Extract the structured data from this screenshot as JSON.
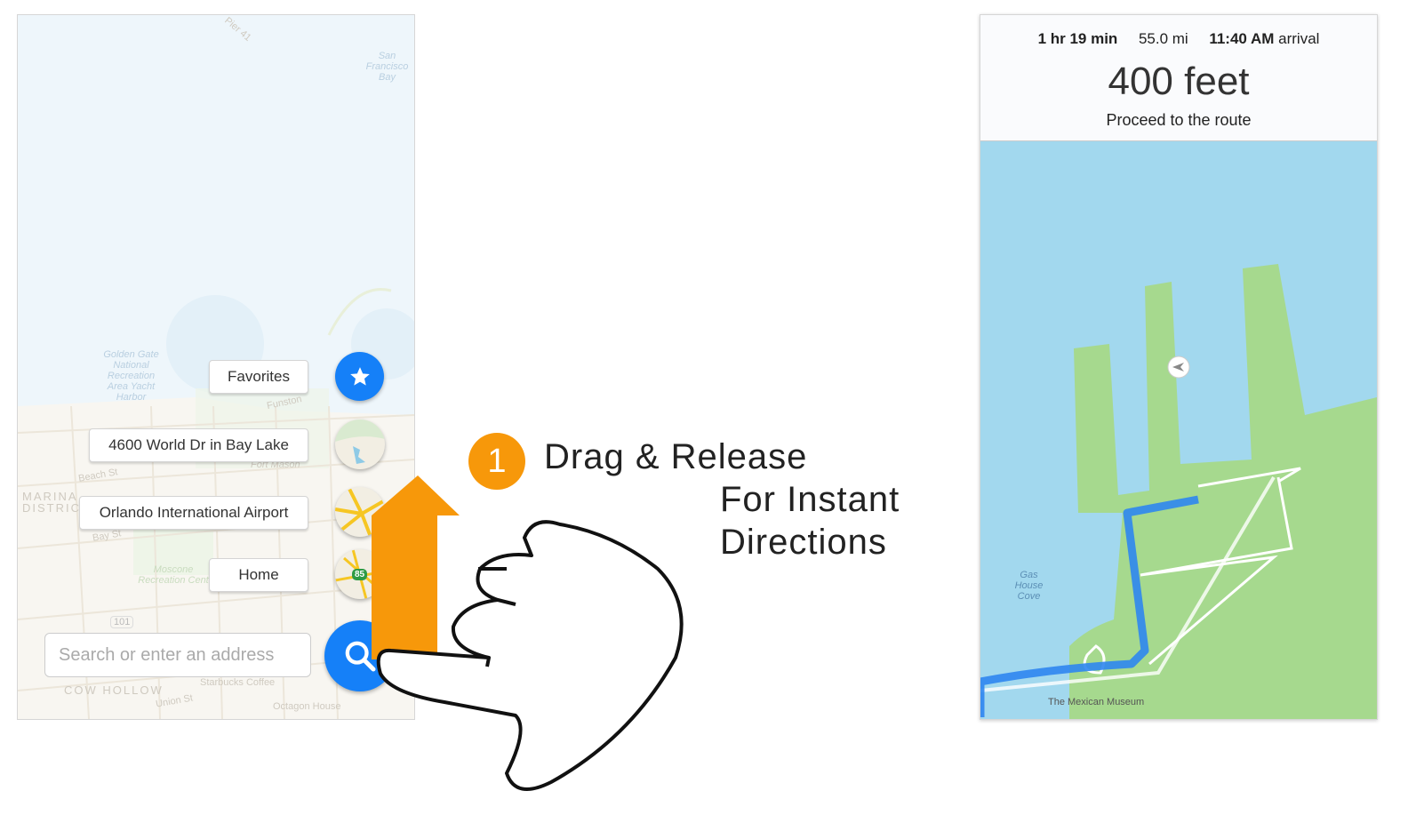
{
  "left_map": {
    "labels": {
      "pier": "Pier 41",
      "bay": "San Francisco Bay",
      "harbor": "Golden Gate National Recreation Area Yacht Harbor",
      "funston": "Funston",
      "fort_mason": "Fort Mason",
      "beach_st": "Beach St",
      "marina": "MARINA DISTRICT",
      "bay_st": "Bay St",
      "moscone": "Moscone Recreation Cent",
      "hwy101": "101",
      "cow_hollow": "COW HOLLOW",
      "starbucks": "Starbucks Coffee",
      "union_st": "Union St",
      "octagon": "Octagon House"
    },
    "favorites_label": "Favorites",
    "recents": [
      {
        "label": "4600 World Dr in Bay Lake"
      },
      {
        "label": "Orlando International Airport"
      },
      {
        "label": "Home",
        "badge": "85"
      }
    ],
    "search_placeholder": "Search or enter an address"
  },
  "instruction": {
    "step_number": "1",
    "line1": "Drag & Release",
    "line2": "For Instant",
    "line3": "Directions",
    "arrow_color": "#f7980a"
  },
  "nav": {
    "duration": "1 hr 19 min",
    "distance": "55.0 mi",
    "arrival_time": "11:40 AM",
    "arrival_label": "arrival",
    "maneuver_distance": "400 feet",
    "instruction": "Proceed to the route",
    "map_labels": {
      "cove": "Gas House Cove",
      "museum": "The Mexican Museum"
    },
    "route_color": "#2f86f0"
  }
}
